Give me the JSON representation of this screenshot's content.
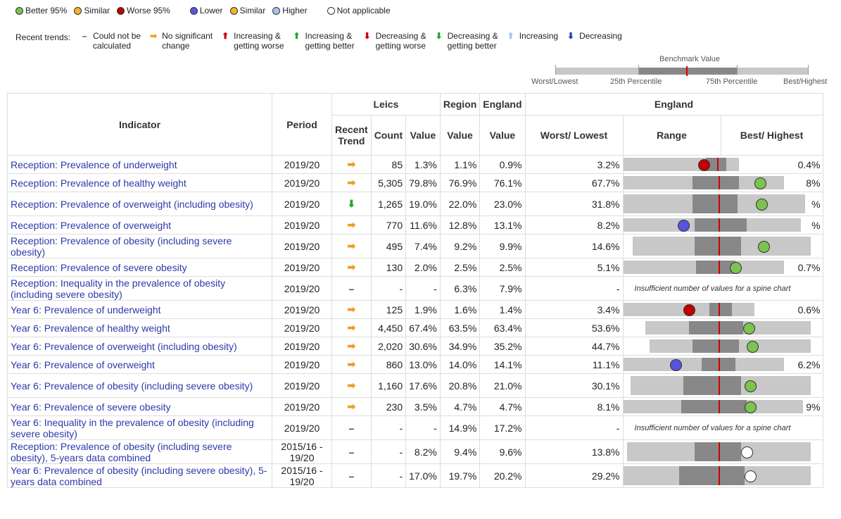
{
  "legend": {
    "compare": [
      {
        "label": "Better 95%",
        "color": "#7cc34f"
      },
      {
        "label": "Similar",
        "color": "#f0b429"
      },
      {
        "label": "Worse 95%",
        "color": "#c00000"
      },
      {
        "label": "Lower",
        "color": "#5555dd"
      },
      {
        "label": "Similar",
        "color": "#f0b429"
      },
      {
        "label": "Higher",
        "color": "#a9c4ec"
      },
      {
        "label": "Not applicable",
        "color": "#ffffff"
      }
    ],
    "trends_label": "Recent trends:",
    "trends": [
      {
        "symbol": "–",
        "color": "#444",
        "line1": "Could not be",
        "line2": "calculated"
      },
      {
        "symbol": "➡",
        "color": "#f39a1e",
        "line1": "No significant",
        "line2": "change"
      },
      {
        "symbol": "⬆",
        "color": "#c00",
        "line1": "Increasing &",
        "line2": "getting worse"
      },
      {
        "symbol": "⬆",
        "color": "#2aa62a",
        "line1": "Increasing &",
        "line2": "getting better"
      },
      {
        "symbol": "⬇",
        "color": "#c00",
        "line1": "Decreasing &",
        "line2": "getting worse"
      },
      {
        "symbol": "⬇",
        "color": "#2aa62a",
        "line1": "Decreasing &",
        "line2": "getting better"
      },
      {
        "symbol": "⬆",
        "color": "#a9c4ec",
        "line1": "Increasing",
        "line2": ""
      },
      {
        "symbol": "⬇",
        "color": "#1a3fb5",
        "line1": "Decreasing",
        "line2": ""
      }
    ]
  },
  "benchmark": {
    "title": "Benchmark Value",
    "worst": "Worst/Lowest",
    "p25": "25th Percentile",
    "p75": "75th Percentile",
    "best": "Best/Highest"
  },
  "headers": {
    "indicator": "Indicator",
    "period": "Period",
    "leics": "Leics",
    "region": "Region",
    "england": "England",
    "england_spine": "England",
    "recent_trend": "Recent Trend",
    "count": "Count",
    "value": "Value",
    "region_value": "Value",
    "england_value": "Value",
    "worst": "Worst/ Lowest",
    "range": "Range",
    "best": "Best/ Highest"
  },
  "rows": [
    {
      "indicator": "Reception: Prevalence of underweight",
      "period": "2019/20",
      "trend": "➡",
      "trend_color": "#f39a1e",
      "count": "85",
      "value": "1.3%",
      "region": "1.1%",
      "england": "0.9%",
      "worst": "3.2%",
      "best": "0.4%",
      "spine": {
        "bg": [
          0.0,
          0.62
        ],
        "mid": [
          0.44,
          0.55
        ],
        "red": 0.5,
        "dot": 0.43,
        "dot_color": "#c00000"
      }
    },
    {
      "indicator": "Reception: Prevalence of healthy weight",
      "period": "2019/20",
      "trend": "➡",
      "trend_color": "#f39a1e",
      "count": "5,305",
      "value": "79.8%",
      "region": "76.9%",
      "england": "76.1%",
      "worst": "67.7%",
      "best": "8%",
      "spine": {
        "bg": [
          0.0,
          0.86
        ],
        "mid": [
          0.37,
          0.62
        ],
        "red": 0.51,
        "dot": 0.73,
        "dot_color": "#7cc34f"
      }
    },
    {
      "indicator": "Reception: Prevalence of overweight (including obesity)",
      "period": "2019/20",
      "trend": "⬇",
      "trend_color": "#2aa62a",
      "count": "1,265",
      "value": "19.0%",
      "region": "22.0%",
      "england": "23.0%",
      "worst": "31.8%",
      "best": "%",
      "spine": {
        "bg": [
          0.0,
          0.97
        ],
        "mid": [
          0.37,
          0.61
        ],
        "red": 0.51,
        "dot": 0.74,
        "dot_color": "#7cc34f"
      }
    },
    {
      "indicator": "Reception: Prevalence of overweight",
      "period": "2019/20",
      "trend": "➡",
      "trend_color": "#f39a1e",
      "count": "770",
      "value": "11.6%",
      "region": "12.8%",
      "england": "13.1%",
      "worst": "8.2%",
      "best": "%",
      "spine": {
        "bg": [
          0.0,
          0.95
        ],
        "mid": [
          0.38,
          0.66
        ],
        "red": 0.51,
        "dot": 0.32,
        "dot_color": "#5555dd"
      }
    },
    {
      "indicator": "Reception: Prevalence of obesity (including severe obesity)",
      "period": "2019/20",
      "trend": "➡",
      "trend_color": "#f39a1e",
      "count": "495",
      "value": "7.4%",
      "region": "9.2%",
      "england": "9.9%",
      "worst": "14.6%",
      "best": "",
      "spine": {
        "bg": [
          0.05,
          1.0
        ],
        "mid": [
          0.38,
          0.63
        ],
        "red": 0.51,
        "dot": 0.75,
        "dot_color": "#7cc34f"
      }
    },
    {
      "indicator": "Reception: Prevalence of severe obesity",
      "period": "2019/20",
      "trend": "➡",
      "trend_color": "#f39a1e",
      "count": "130",
      "value": "2.0%",
      "region": "2.5%",
      "england": "2.5%",
      "worst": "5.1%",
      "best": "0.7%",
      "spine": {
        "bg": [
          0.0,
          0.86
        ],
        "mid": [
          0.39,
          0.6
        ],
        "red": 0.51,
        "dot": 0.6,
        "dot_color": "#7cc34f"
      }
    },
    {
      "indicator": "Reception: Inequality in the prevalence of obesity (including severe obesity)",
      "period": "2019/20",
      "trend": "–",
      "trend_color": "#444",
      "count": "-",
      "value": "-",
      "region": "6.3%",
      "england": "7.9%",
      "worst": "-",
      "best": "",
      "msg": "Insufficient number of values for a spine chart"
    },
    {
      "indicator": "Year 6: Prevalence of underweight",
      "period": "2019/20",
      "trend": "➡",
      "trend_color": "#f39a1e",
      "count": "125",
      "value": "1.9%",
      "region": "1.6%",
      "england": "1.4%",
      "worst": "3.4%",
      "best": "0.6%",
      "spine": {
        "bg": [
          0.0,
          0.7
        ],
        "mid": [
          0.46,
          0.58
        ],
        "red": 0.51,
        "dot": 0.35,
        "dot_color": "#c00000"
      }
    },
    {
      "indicator": "Year 6: Prevalence of healthy weight",
      "period": "2019/20",
      "trend": "➡",
      "trend_color": "#f39a1e",
      "count": "4,450",
      "value": "67.4%",
      "region": "63.5%",
      "england": "63.4%",
      "worst": "53.6%",
      "best": "",
      "spine": {
        "bg": [
          0.12,
          1.0
        ],
        "mid": [
          0.35,
          0.64
        ],
        "red": 0.51,
        "dot": 0.67,
        "dot_color": "#7cc34f"
      }
    },
    {
      "indicator": "Year 6: Prevalence of overweight (including obesity)",
      "period": "2019/20",
      "trend": "➡",
      "trend_color": "#f39a1e",
      "count": "2,020",
      "value": "30.6%",
      "region": "34.9%",
      "england": "35.2%",
      "worst": "44.7%",
      "best": "",
      "spine": {
        "bg": [
          0.14,
          1.0
        ],
        "mid": [
          0.37,
          0.62
        ],
        "red": 0.51,
        "dot": 0.69,
        "dot_color": "#7cc34f"
      }
    },
    {
      "indicator": "Year 6: Prevalence of overweight",
      "period": "2019/20",
      "trend": "➡",
      "trend_color": "#f39a1e",
      "count": "860",
      "value": "13.0%",
      "region": "14.0%",
      "england": "14.1%",
      "worst": "11.1%",
      "best": "6.2%",
      "spine": {
        "bg": [
          0.0,
          0.86
        ],
        "mid": [
          0.42,
          0.6
        ],
        "red": 0.51,
        "dot": 0.28,
        "dot_color": "#5555dd"
      }
    },
    {
      "indicator": "Year 6: Prevalence of obesity (including severe obesity)",
      "period": "2019/20",
      "trend": "➡",
      "trend_color": "#f39a1e",
      "count": "1,160",
      "value": "17.6%",
      "region": "20.8%",
      "england": "21.0%",
      "worst": "30.1%",
      "best": "",
      "spine": {
        "bg": [
          0.04,
          1.0
        ],
        "mid": [
          0.32,
          0.63
        ],
        "red": 0.51,
        "dot": 0.68,
        "dot_color": "#7cc34f"
      }
    },
    {
      "indicator": "Year 6: Prevalence of severe obesity",
      "period": "2019/20",
      "trend": "➡",
      "trend_color": "#f39a1e",
      "count": "230",
      "value": "3.5%",
      "region": "4.7%",
      "england": "4.7%",
      "worst": "8.1%",
      "best": "9%",
      "spine": {
        "bg": [
          0.0,
          0.96
        ],
        "mid": [
          0.31,
          0.66
        ],
        "red": 0.51,
        "dot": 0.68,
        "dot_color": "#7cc34f"
      }
    },
    {
      "indicator": "Year 6: Inequality in the prevalence of obesity (including severe obesity)",
      "period": "2019/20",
      "trend": "–",
      "trend_color": "#444",
      "count": "-",
      "value": "-",
      "region": "14.9%",
      "england": "17.2%",
      "worst": "-",
      "best": "",
      "msg": "Insufficient number of values for a spine chart"
    },
    {
      "indicator": "Reception: Prevalence of obesity (including severe obesity), 5-years data combined",
      "period": "2015/16 - 19/20",
      "trend": "–",
      "trend_color": "#444",
      "count": "-",
      "value": "8.2%",
      "region": "9.4%",
      "england": "9.6%",
      "worst": "13.8%",
      "best": "",
      "spine": {
        "bg": [
          0.02,
          1.0
        ],
        "mid": [
          0.38,
          0.63
        ],
        "red": 0.51,
        "dot": 0.66,
        "dot_color": "#ffffff"
      }
    },
    {
      "indicator": "Year 6: Prevalence of obesity (including severe obesity), 5-years data combined",
      "period": "2015/16 - 19/20",
      "trend": "–",
      "trend_color": "#444",
      "count": "-",
      "value": "17.0%",
      "region": "19.7%",
      "england": "20.2%",
      "worst": "29.2%",
      "best": "",
      "spine": {
        "bg": [
          0.0,
          1.0
        ],
        "mid": [
          0.3,
          0.65
        ],
        "red": 0.51,
        "dot": 0.68,
        "dot_color": "#ffffff"
      }
    }
  ]
}
